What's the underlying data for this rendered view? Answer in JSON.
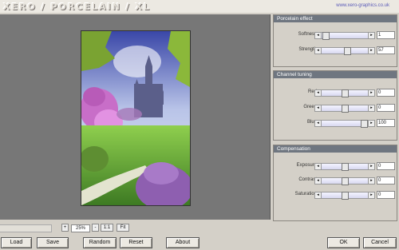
{
  "app": {
    "logo": "XERO / PORCELAIN / XL",
    "site_link": "www.xero-graphics.co.uk"
  },
  "zoom": {
    "minus": "+",
    "value": "25%",
    "plus": "-",
    "one_to_one": "1:1",
    "fit": "Fit"
  },
  "buttons": {
    "load": "Load",
    "save": "Save",
    "random": "Random",
    "reset": "Reset",
    "about": "About",
    "ok": "OK",
    "cancel": "Cancel"
  },
  "panels": {
    "porcelain": {
      "title": "Porcelain effect",
      "softness": {
        "label": "Softness",
        "value": "1",
        "level": 0.02
      },
      "strength": {
        "label": "Strength",
        "value": "57",
        "level": 0.57
      }
    },
    "channel": {
      "title": "Channel tuning",
      "red": {
        "label": "Red",
        "value": "0",
        "level": 0.5
      },
      "green": {
        "label": "Green",
        "value": "0",
        "level": 0.5
      },
      "blue": {
        "label": "Blue",
        "value": "100",
        "level": 1.0
      }
    },
    "compensation": {
      "title": "Compensation",
      "exposure": {
        "label": "Exposure",
        "value": "0",
        "level": 0.5
      },
      "contrast": {
        "label": "Contrast",
        "value": "0",
        "level": 0.5
      },
      "saturation": {
        "label": "Saturation",
        "value": "0",
        "level": 0.5
      }
    }
  },
  "colors": {
    "panel_header": "#6f7680",
    "preview_bg": "#777777",
    "window_bg": "#d4d0c8"
  }
}
